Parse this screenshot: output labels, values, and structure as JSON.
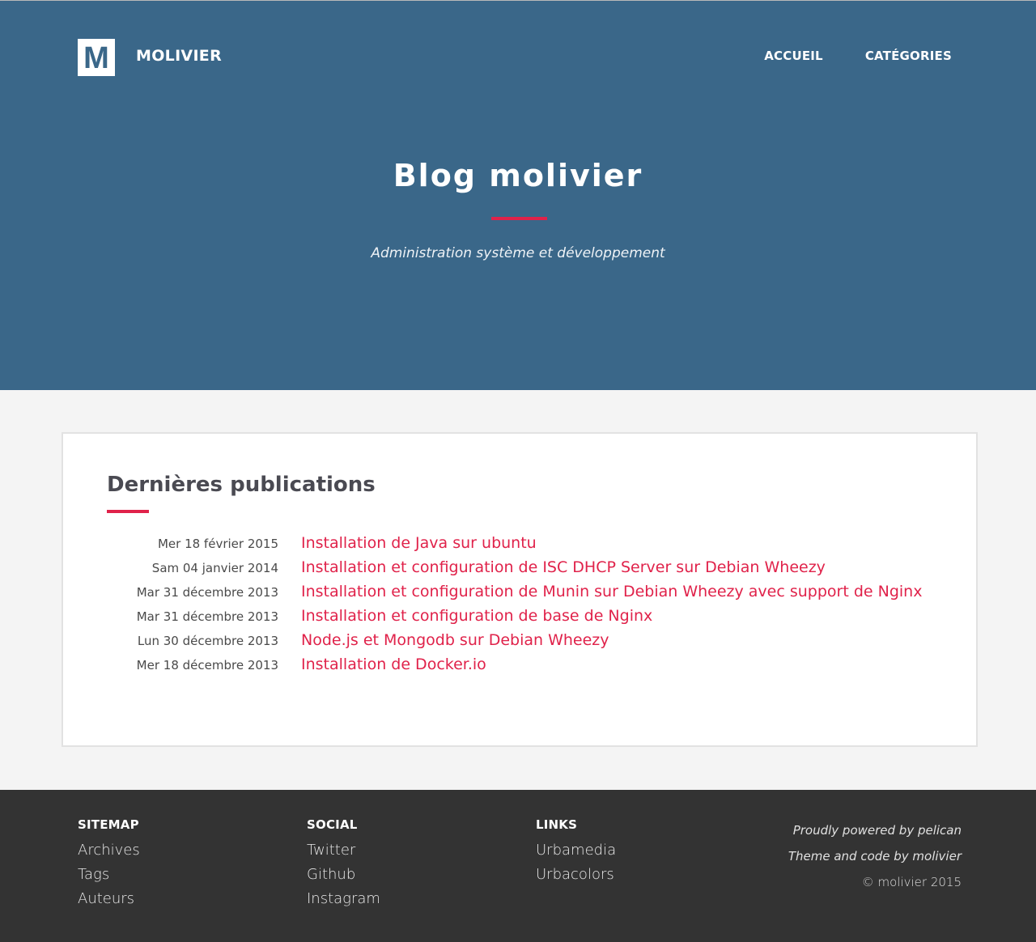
{
  "header": {
    "logo_letter": "M",
    "brand": "MOLIVIER",
    "nav": [
      "ACCUEIL",
      "CATÉGORIES"
    ],
    "title": "Blog molivier",
    "tagline": "Administration système et développement"
  },
  "main": {
    "heading": "Dernières publications",
    "posts": [
      {
        "date": "Mer 18 février 2015",
        "title": "Installation de Java sur ubuntu"
      },
      {
        "date": "Sam 04 janvier 2014",
        "title": "Installation et configuration de ISC DHCP Server sur Debian Wheezy"
      },
      {
        "date": "Mar 31 décembre 2013",
        "title": "Installation et configuration de Munin sur Debian Wheezy avec support de Nginx"
      },
      {
        "date": "Mar 31 décembre 2013",
        "title": "Installation et configuration de base de Nginx"
      },
      {
        "date": "Lun 30 décembre 2013",
        "title": "Node.js et Mongodb sur Debian Wheezy"
      },
      {
        "date": "Mer 18 décembre 2013",
        "title": "Installation de Docker.io"
      }
    ]
  },
  "footer": {
    "sitemap": {
      "title": "SITEMAP",
      "links": [
        "Archives",
        "Tags",
        "Auteurs"
      ]
    },
    "social": {
      "title": "SOCIAL",
      "links": [
        "Twitter",
        "Github",
        "Instagram"
      ]
    },
    "links": {
      "title": "LINKS",
      "links": [
        "Urbamedia",
        "Urbacolors"
      ]
    },
    "credits": {
      "powered": "Proudly powered by pelican",
      "theme": "Theme and code by molivier",
      "copyright": "© molivier 2015"
    }
  },
  "colors": {
    "header_bg": "#3a6789",
    "accent": "#e0224a",
    "footer_bg": "#333333",
    "page_bg": "#f4f4f4"
  }
}
